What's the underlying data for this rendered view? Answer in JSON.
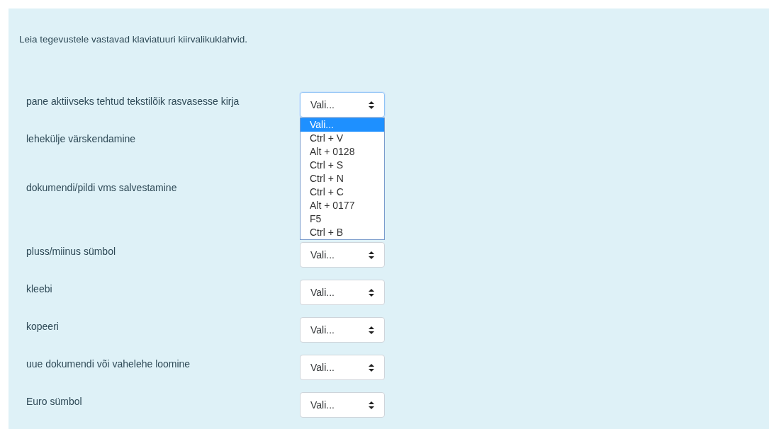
{
  "instruction": "Leia tegevustele vastavad klaviatuuri kiirvalikuklahvid.",
  "rows": [
    {
      "label": "pane aktiivseks tehtud tekstilõik rasvasesse kirja",
      "value": "Vali...",
      "open": true,
      "options": [
        {
          "label": "Vali...",
          "selected": true
        },
        {
          "label": "Ctrl + V",
          "selected": false
        },
        {
          "label": "Alt + 0128",
          "selected": false
        },
        {
          "label": "Ctrl + S",
          "selected": false
        },
        {
          "label": "Ctrl + N",
          "selected": false
        },
        {
          "label": "Ctrl + C",
          "selected": false
        },
        {
          "label": "Alt + 0177",
          "selected": false
        },
        {
          "label": "F5",
          "selected": false
        },
        {
          "label": "Ctrl + B",
          "selected": false
        }
      ]
    },
    {
      "label": "lehekülje värskendamine"
    },
    {
      "label": "dokumendi/pildi vms salvestamine"
    },
    {
      "label": "pluss/miinus sümbol",
      "value": "Vali...",
      "open": false
    },
    {
      "label": "kleebi",
      "value": "Vali...",
      "open": false
    },
    {
      "label": "kopeeri",
      "value": "Vali...",
      "open": false
    },
    {
      "label": "uue dokumendi või vahelehe loomine",
      "value": "Vali...",
      "open": false
    },
    {
      "label": "Euro sümbol",
      "value": "Vali...",
      "open": false
    }
  ]
}
